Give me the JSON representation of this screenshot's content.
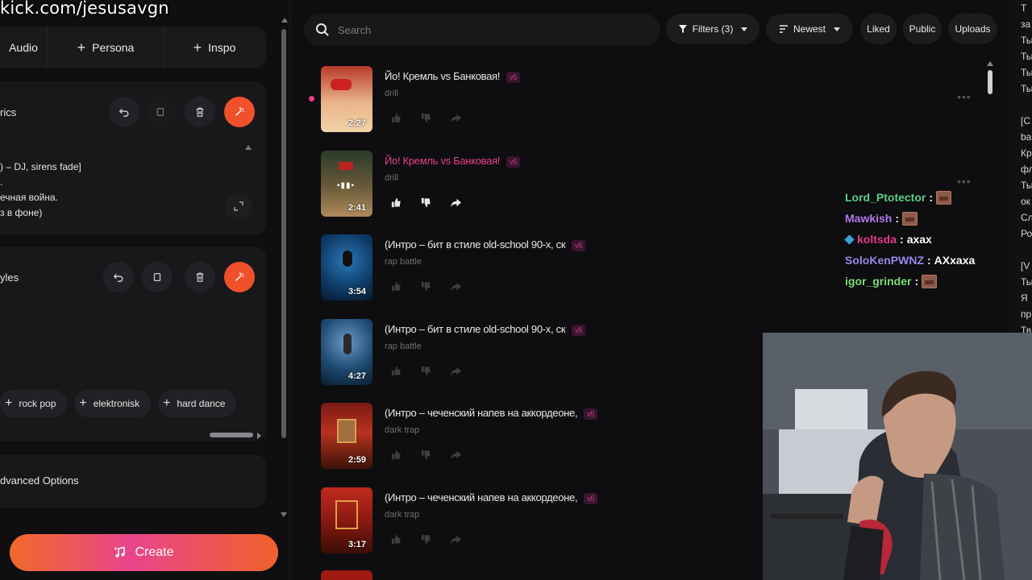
{
  "watermark": "kick.com/jesusavgn",
  "left_panel": {
    "top_buttons": [
      "Audio",
      "Persona",
      "Inspo"
    ],
    "lyrics_label": "rics",
    "lyrics_lines": [
      ") – DJ, sirens fade]",
      ".",
      "ечная война.",
      "з в фоне)"
    ],
    "styles_label": "yles",
    "style_tags": [
      "rock pop",
      "elektronisk",
      "hard dance"
    ],
    "advanced_label": "dvanced Options",
    "create_label": "Create"
  },
  "toolbar": {
    "search_placeholder": "Search",
    "filters": "Filters (3)",
    "sort": "Newest",
    "liked": "Liked",
    "public": "Public",
    "uploads": "Uploads"
  },
  "songs": [
    {
      "title": "Йо! Кремль vs Банковая!",
      "badge": "v5",
      "genre": "drill",
      "duration": "2:27",
      "highlight": false
    },
    {
      "title": "Йо! Кремль vs Банковая!",
      "badge": "v5",
      "genre": "drill",
      "duration": "2:41",
      "highlight": true
    },
    {
      "title": "(Интро – бит в стиле old-school 90-х, ск",
      "badge": "v5",
      "genre": "rap battle",
      "duration": "3:54",
      "highlight": false
    },
    {
      "title": "(Интро – бит в стиле old-school 90-х, ск",
      "badge": "v5",
      "genre": "rap battle",
      "duration": "4:27",
      "highlight": false
    },
    {
      "title": "(Интро – чеченский напев на аккордеоне,",
      "badge": "v5",
      "genre": "dark trap",
      "duration": "2:59",
      "highlight": false
    },
    {
      "title": "(Интро – чеченский напев на аккордеоне,",
      "badge": "v5",
      "genre": "dark trap",
      "duration": "3:17",
      "highlight": false
    }
  ],
  "chat": [
    {
      "user": "Lord_Ptotector",
      "color": "#5fd08a",
      "msg": "",
      "emote": true
    },
    {
      "user": "Mawkish",
      "color": "#b47cf0",
      "msg": "",
      "emote": true
    },
    {
      "user": "koltsda",
      "color": "#e8408a",
      "msg": "axax",
      "emote": false,
      "cube": true
    },
    {
      "user": "SoloKenPWNZ",
      "color": "#9b8cf0",
      "msg": "АХхаха",
      "emote": false
    },
    {
      "user": "igor_grinder",
      "color": "#7ee07a",
      "msg": "",
      "emote": true
    }
  ],
  "right_chat_lines": [
    "Т",
    "за",
    "Ты",
    "Ты",
    "Ты",
    "Ты",
    "",
    "[С",
    "ba",
    "Кр",
    "фл",
    "Ты",
    "ок",
    "Сл",
    "Ро",
    "",
    "[V",
    "Ты",
    "Я",
    "пр",
    "Тв"
  ]
}
